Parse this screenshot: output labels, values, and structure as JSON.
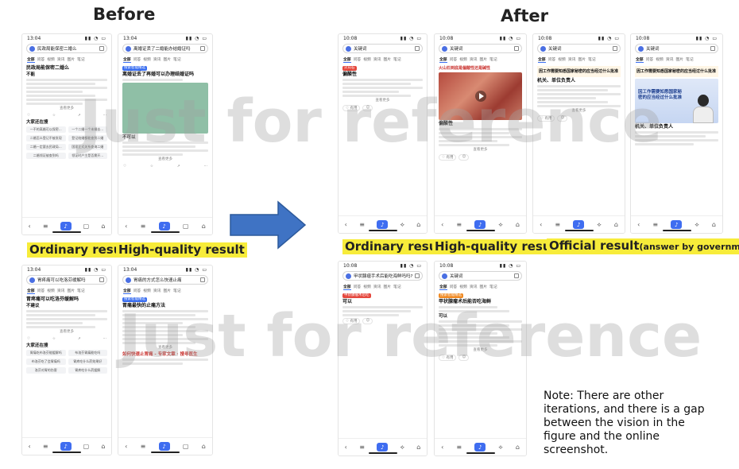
{
  "headers": {
    "before": "Before",
    "after": "After"
  },
  "labels": {
    "ordinary": "Ordinary result",
    "high_quality": "High-quality result",
    "official": "Official result",
    "official_small": "(answer by government)"
  },
  "note": "Note: There are other iterations, and there is a gap between the vision in the figure and the online screenshot.",
  "watermark": "Just for reference",
  "status": {
    "time_before": "13:04",
    "time_after": "10:08"
  },
  "tabs_before": [
    "全部",
    "问答",
    "视频",
    "资讯",
    "图片",
    "笔记",
    "小红书"
  ],
  "tabs_after": [
    "全部",
    "问答",
    "视频",
    "资讯",
    "图片",
    "笔记",
    "文库",
    "视频"
  ],
  "phones": {
    "b1": {
      "query": "民政局能保密二婚么",
      "title": "民政局能保密二婚么",
      "answer": "不能",
      "more": "查看更多",
      "section": "大家还在搜",
      "chips": [
        "一不的离婚可以保密…",
        "一个二婚一个未婚去…",
        "二婚怎么登记不被发现",
        "登记结婚都能查到二婚",
        "二婚一定要去民政局…",
        "国家正式关系查询二婚",
        "二婚领证被查到吗",
        "领证时户主是否需开…"
      ]
    },
    "b2": {
      "query": "离婚证丢了二婚能办结婚证吗",
      "badge": "搜索智能精选",
      "title": "离婚证丢了再婚可以办理结婚证吗",
      "answer": "不可以",
      "more": "查看更多"
    },
    "b3": {
      "query": "胃疼痛可以吃洛芬缓解吗",
      "title": "胃疼痛可以吃洛芬缓解吗",
      "answer": "不建议",
      "more": "查看更多",
      "section": "大家还在搜",
      "chips": [
        "胃痛吃布洛芬能缓解吗",
        "布洛芬胃痛能吃吗",
        "布洛芬吃了会胃痛吗",
        "胃疼吃什么药效果好",
        "洛芬对胃的伤害",
        "胃疼吃什么药缓解",
        "胃痛可以吃止痛药吗",
        "胃疼吃布洛芬有用吗"
      ]
    },
    "b4": {
      "query": "胃痛的方式怎么快速止痛",
      "badge": "搜索智能精选",
      "title": "胃痛最快的止痛方法",
      "more": "查看更多",
      "sub": "如何快速止胃痛 - 专家文章 · 搜寻医生"
    },
    "a1": {
      "query": "关键词",
      "tag": "火山石",
      "title": "偏酸性",
      "more": "查看更多"
    },
    "a2": {
      "query": "关键词",
      "banner": "火山石到底是偏酸性还是碱性",
      "title": "偏酸性",
      "more": "查看更多"
    },
    "a3": {
      "query": "关键词",
      "banner": "因工作需要知悉国家秘密的应当经过什么批准",
      "title": "机关、单位负责人",
      "more": "查看更多"
    },
    "a4": {
      "query": "关键词",
      "banner": "因工作需要知悉国家秘密的应当经过什么批准",
      "img_text": "因工作需要知悉国家秘密的应当经过什么批准",
      "title": "机关、单位负责人"
    },
    "a5": {
      "query": "甲状腺瘤手术后能吃海鲜吗吗?",
      "tag": "甲状腺瘤术后吃",
      "title": "可以"
    },
    "a6": {
      "query": "关键词",
      "badge": "搜索智能精选",
      "title": "甲状腺瘤术后能否吃海鲜",
      "answer": "可以",
      "more": "查看更多"
    }
  }
}
